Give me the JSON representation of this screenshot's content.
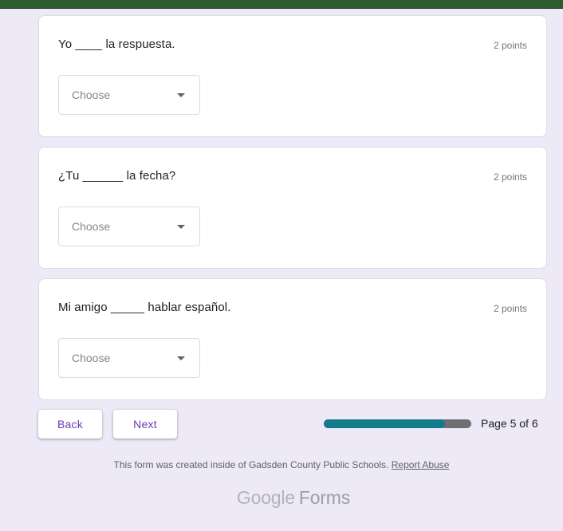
{
  "questions": [
    {
      "text": "Yo ____ la respuesta.",
      "points": "2 points",
      "placeholder": "Choose"
    },
    {
      "text": "¿Tu ______ la fecha?",
      "points": "2 points",
      "placeholder": "Choose"
    },
    {
      "text": "Mi amigo _____ hablar español.",
      "points": "2 points",
      "placeholder": "Choose"
    }
  ],
  "nav": {
    "back_label": "Back",
    "next_label": "Next"
  },
  "progress": {
    "fraction": 0.82,
    "label": "Page 5 of 6",
    "fill_color": "#137c8b"
  },
  "footer": {
    "note": "This form was created inside of Gadsden County Public Schools.",
    "report_link": "Report Abuse",
    "logo_google": "Google",
    "logo_forms": "Forms"
  },
  "colors": {
    "accent": "#673ab7",
    "background": "#ede9f7",
    "header_bar": "#2e5a2f"
  }
}
